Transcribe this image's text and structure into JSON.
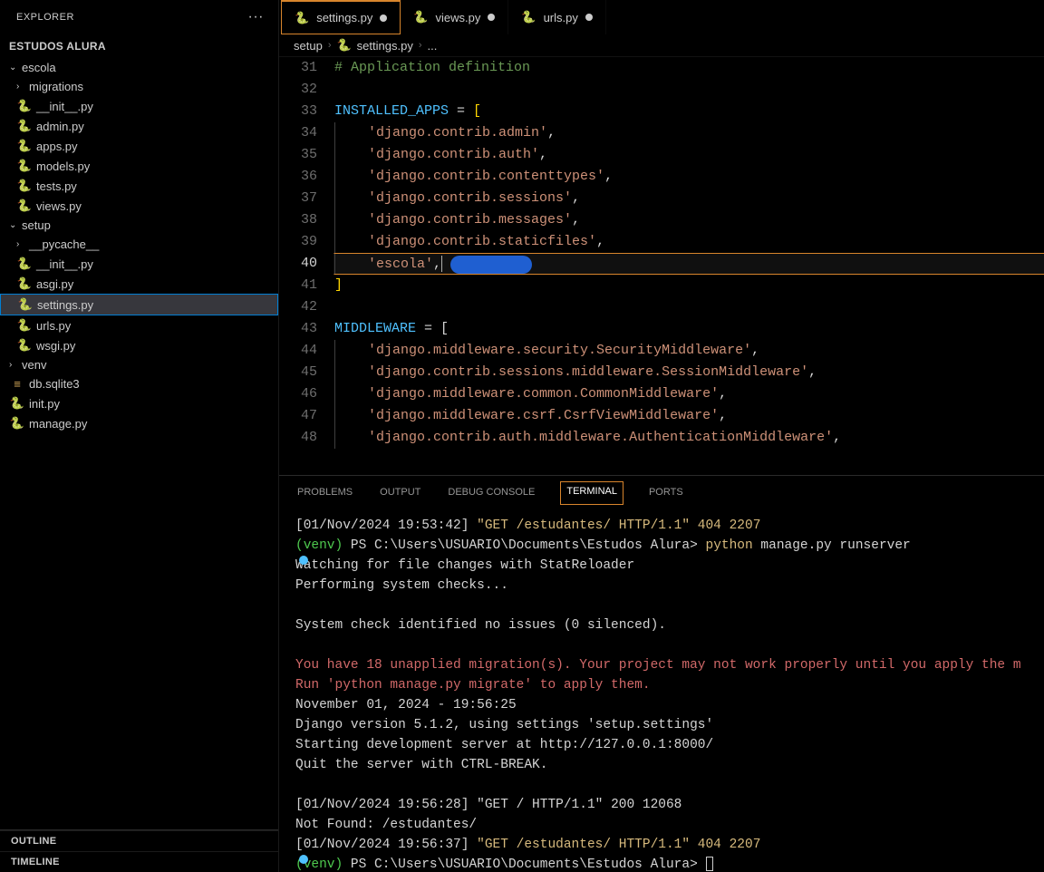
{
  "explorer": {
    "title": "EXPLORER",
    "project": "ESTUDOS ALURA",
    "outline": "OUTLINE",
    "timeline": "TIMELINE"
  },
  "tree": {
    "escola": "escola",
    "migrations": "migrations",
    "init_escola": "__init__.py",
    "admin": "admin.py",
    "apps": "apps.py",
    "models": "models.py",
    "tests": "tests.py",
    "views": "views.py",
    "setup": "setup",
    "pycache": "__pycache__",
    "init_setup": "__init__.py",
    "asgi": "asgi.py",
    "settings": "settings.py",
    "urls": "urls.py",
    "wsgi": "wsgi.py",
    "venv": "venv",
    "db": "db.sqlite3",
    "init_root": "init.py",
    "manage": "manage.py"
  },
  "tabs": {
    "t1": "settings.py",
    "t2": "views.py",
    "t3": "urls.py"
  },
  "breadcrumb": {
    "b1": "setup",
    "b2": "settings.py",
    "b3": "..."
  },
  "code": {
    "lines": [
      "31",
      "32",
      "33",
      "34",
      "35",
      "36",
      "37",
      "38",
      "39",
      "40",
      "41",
      "42",
      "43",
      "44",
      "45",
      "46",
      "47",
      "48"
    ],
    "comment": "# Application definition",
    "installed": "INSTALLED_APPS",
    "eq": " = ",
    "ob": "[",
    "cb": "]",
    "s_admin": "'django.contrib.admin'",
    "s_auth": "'django.contrib.auth'",
    "s_ct": "'django.contrib.contenttypes'",
    "s_sess": "'django.contrib.sessions'",
    "s_msg": "'django.contrib.messages'",
    "s_static": "'django.contrib.staticfiles'",
    "s_escola": "'escola'",
    "comma": ",",
    "middleware": "MIDDLEWARE",
    "m_sec": "'django.middleware.security.SecurityMiddleware'",
    "m_sess": "'django.contrib.sessions.middleware.SessionMiddleware'",
    "m_comm": "'django.middleware.common.CommonMiddleware'",
    "m_csrf": "'django.middleware.csrf.CsrfViewMiddleware'",
    "m_auth": "'django.contrib.auth.middleware.AuthenticationMiddleware'"
  },
  "panel": {
    "problems": "PROBLEMS",
    "output": "OUTPUT",
    "debug": "DEBUG CONSOLE",
    "terminal": "TERMINAL",
    "ports": "PORTS"
  },
  "term": {
    "l1a": "[01/Nov/2024 19:53:42] ",
    "l1b": "\"GET /estudantes/ HTTP/1.1\" 404 2207",
    "l2a": "(venv) ",
    "l2b": "PS C:\\Users\\USUARIO\\Documents\\Estudos Alura> ",
    "l2c": "python ",
    "l2d": "manage.py runserver",
    "l3": "Watching for file changes with StatReloader",
    "l4": "Performing system checks...",
    "l5": "System check identified no issues (0 silenced).",
    "l6": "You have 18 unapplied migration(s). Your project may not work properly until you apply the m",
    "l7": "Run 'python manage.py migrate' to apply them.",
    "l8": "November 01, 2024 - 19:56:25",
    "l9": "Django version 5.1.2, using settings 'setup.settings'",
    "l10": "Starting development server at http://127.0.0.1:8000/",
    "l11": "Quit the server with CTRL-BREAK.",
    "l12a": "[01/Nov/2024 19:56:28] ",
    "l12b": "\"GET / HTTP/1.1\" 200 12068",
    "l13": "Not Found: /estudantes/",
    "l14a": "[01/Nov/2024 19:56:37] ",
    "l14b": "\"GET /estudantes/ HTTP/1.1\" 404 2207",
    "l15a": "(venv) ",
    "l15b": "PS C:\\Users\\USUARIO\\Documents\\Estudos Alura> "
  }
}
